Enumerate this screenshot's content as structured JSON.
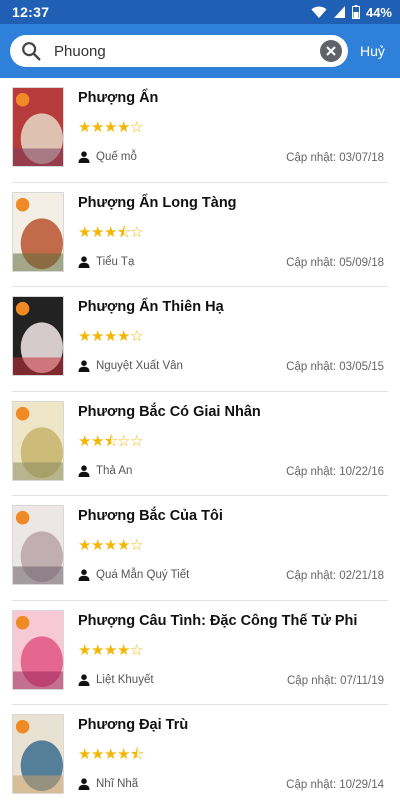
{
  "status_bar": {
    "time": "12:37",
    "battery": "44%",
    "wifi_icon": "wifi-icon",
    "signal_icon": "signal-icon",
    "battery_icon": "battery-icon"
  },
  "search": {
    "value": "Phuong",
    "placeholder": "",
    "cancel_label": "Huỷ"
  },
  "colors": {
    "status_bar": "#1f5fb4",
    "app_bar": "#2f80d9",
    "star": "#f2b705"
  },
  "results": [
    {
      "title": "Phượng Ẩn",
      "rating": 4,
      "author": "Quế mỗ",
      "updated_label": "Cập nhật:",
      "updated": "03/07/18",
      "cover_colors": [
        "#b73b3b",
        "#e6d9c7",
        "#7a3f5c"
      ]
    },
    {
      "title": "Phượng Ẩn Long Tàng",
      "rating": 3.5,
      "author": "Tiểu Tạ",
      "updated_label": "Cập nhật:",
      "updated": "05/09/18",
      "cover_colors": [
        "#f3efe6",
        "#b8542f",
        "#5e6b3a"
      ]
    },
    {
      "title": "Phượng Ẩn Thiên Hạ",
      "rating": 4,
      "author": "Nguyệt Xuất Vân",
      "updated_label": "Cập nhật:",
      "updated": "03/05/15",
      "cover_colors": [
        "#222222",
        "#f4e9ea",
        "#c9313a"
      ]
    },
    {
      "title": "Phương Bắc Có Giai Nhân",
      "rating": 2.5,
      "author": "Thả An",
      "updated_label": "Cập nhật:",
      "updated": "10/22/16",
      "cover_colors": [
        "#efe6c8",
        "#c7b36c",
        "#8b8a5c"
      ]
    },
    {
      "title": "Phương Bắc Của Tôi",
      "rating": 4,
      "author": "Quá Mẫn Quý Tiết",
      "updated_label": "Cập nhật:",
      "updated": "02/21/18",
      "cover_colors": [
        "#ece7e4",
        "#b9a3a8",
        "#6a5c66"
      ]
    },
    {
      "title": "Phượng Câu Tình: Đặc Công Thế Tử Phi",
      "rating": 4,
      "author": "Liệt Khuyết",
      "updated_label": "Cập nhật:",
      "updated": "07/11/19",
      "cover_colors": [
        "#f6c9d5",
        "#e05585",
        "#9b2458"
      ]
    },
    {
      "title": "Phương Đại Trù",
      "rating": 4.5,
      "author": "Nhĩ Nhã",
      "updated_label": "Cập nhật:",
      "updated": "10/29/14",
      "cover_colors": [
        "#e9e2d2",
        "#3b6d8f",
        "#c9a06a"
      ]
    }
  ]
}
